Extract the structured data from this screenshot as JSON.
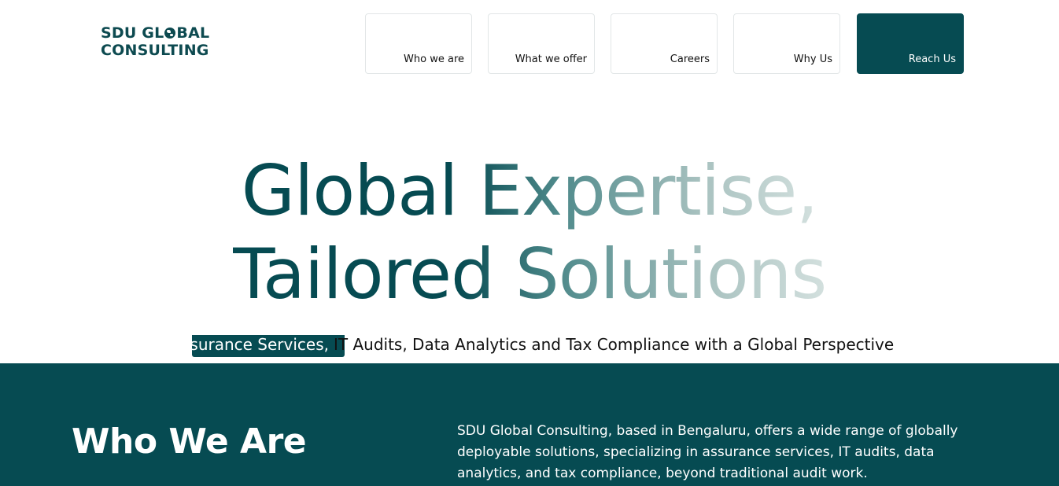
{
  "header": {
    "logo": {
      "line1_before": "SDU GL",
      "line1_after": "BAL",
      "line2": "CONSULTING",
      "icon": "globe-icon"
    },
    "nav": [
      {
        "label": "Who we are"
      },
      {
        "label": "What we offer"
      },
      {
        "label": "Careers"
      },
      {
        "label": "Why Us"
      },
      {
        "label": "Reach Us"
      }
    ]
  },
  "hero": {
    "title_line1": "Global Expertise,",
    "title_line2": "Tailored Solutions",
    "tagline_highlight": "Assurance Services,",
    "tagline_rest": " IT Audits, Data Analytics and Tax Compliance with a Global Perspective"
  },
  "who_we_are": {
    "title": "Who We Are",
    "text": "SDU Global Consulting, based in Bengaluru, offers a wide range of globally deployable solutions, specializing in assurance services, IT audits, data analytics, and tax compliance, beyond traditional audit work."
  },
  "colors": {
    "brand": "#064b52",
    "gradient_end": "#d3e0de",
    "text": "#111111",
    "background": "#ffffff"
  }
}
